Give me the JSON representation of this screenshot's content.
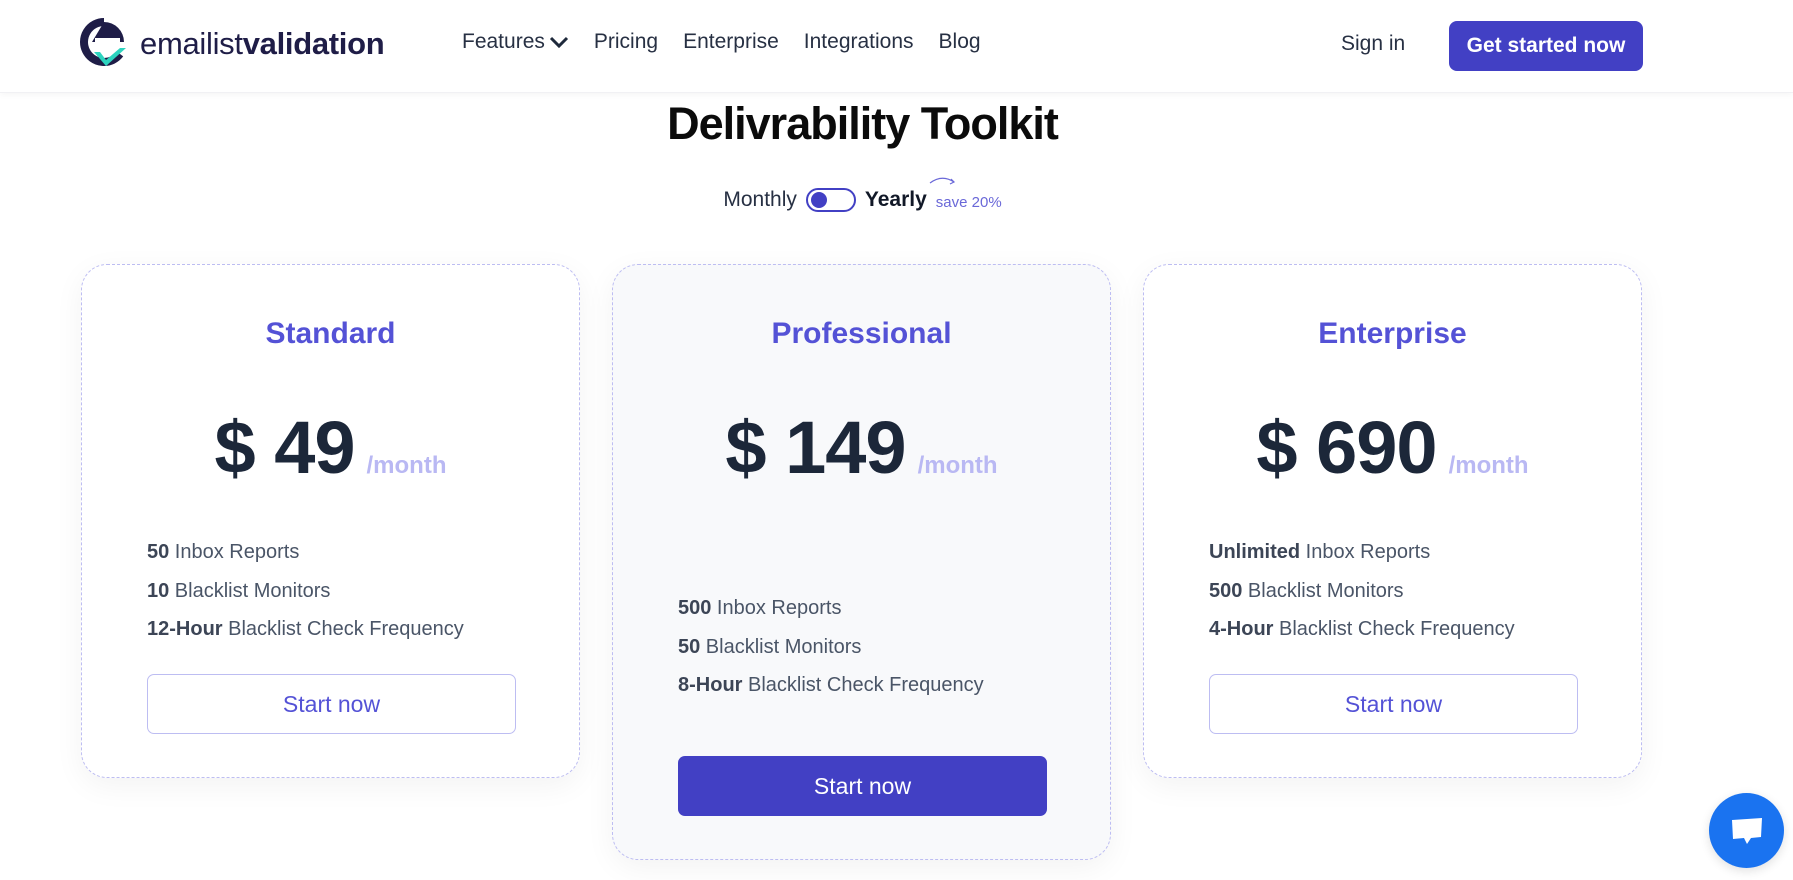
{
  "header": {
    "logo": {
      "text_light": "emailist",
      "text_bold": "validation",
      "icon": "e-check-logo-icon"
    },
    "nav": [
      {
        "label": "Features",
        "has_dropdown": true
      },
      {
        "label": "Pricing"
      },
      {
        "label": "Enterprise"
      },
      {
        "label": "Integrations"
      },
      {
        "label": "Blog"
      }
    ],
    "sign_in": "Sign in",
    "cta": "Get started now"
  },
  "page": {
    "title": "Delivrability Toolkit",
    "billing": {
      "monthly_label": "Monthly",
      "yearly_label": "Yearly",
      "selected": "Yearly",
      "save_note": "save 20%"
    }
  },
  "plans": [
    {
      "name": "Standard",
      "price": "$ 49",
      "unit": "/month",
      "features": [
        {
          "bold": "50",
          "text": " Inbox Reports"
        },
        {
          "bold": "10",
          "text": " Blacklist Monitors"
        },
        {
          "bold": "12-Hour",
          "text": " Blacklist Check Frequency"
        }
      ],
      "button": "Start now"
    },
    {
      "name": "Professional",
      "price": "$ 149",
      "unit": "/month",
      "features": [
        {
          "bold": "500",
          "text": " Inbox Reports"
        },
        {
          "bold": "50",
          "text": " Blacklist Monitors"
        },
        {
          "bold": "8-Hour",
          "text": " Blacklist Check Frequency"
        }
      ],
      "button": "Start now"
    },
    {
      "name": "Enterprise",
      "price": "$ 690",
      "unit": "/month",
      "features": [
        {
          "bold": "Unlimited",
          "text": " Inbox Reports"
        },
        {
          "bold": "500",
          "text": " Blacklist Monitors"
        },
        {
          "bold": "4-Hour",
          "text": " Blacklist Check Frequency"
        }
      ],
      "button": "Start now"
    }
  ],
  "chat": {
    "icon": "chat-bubble-icon"
  },
  "colors": {
    "accent": "#4240c4",
    "plan_title": "#5452d6",
    "price": "#1c2739",
    "price_unit": "#b9b8f3",
    "chat": "#1a73f0",
    "logo_teal": "#2dd4bf",
    "logo_dark": "#1f1d47"
  }
}
